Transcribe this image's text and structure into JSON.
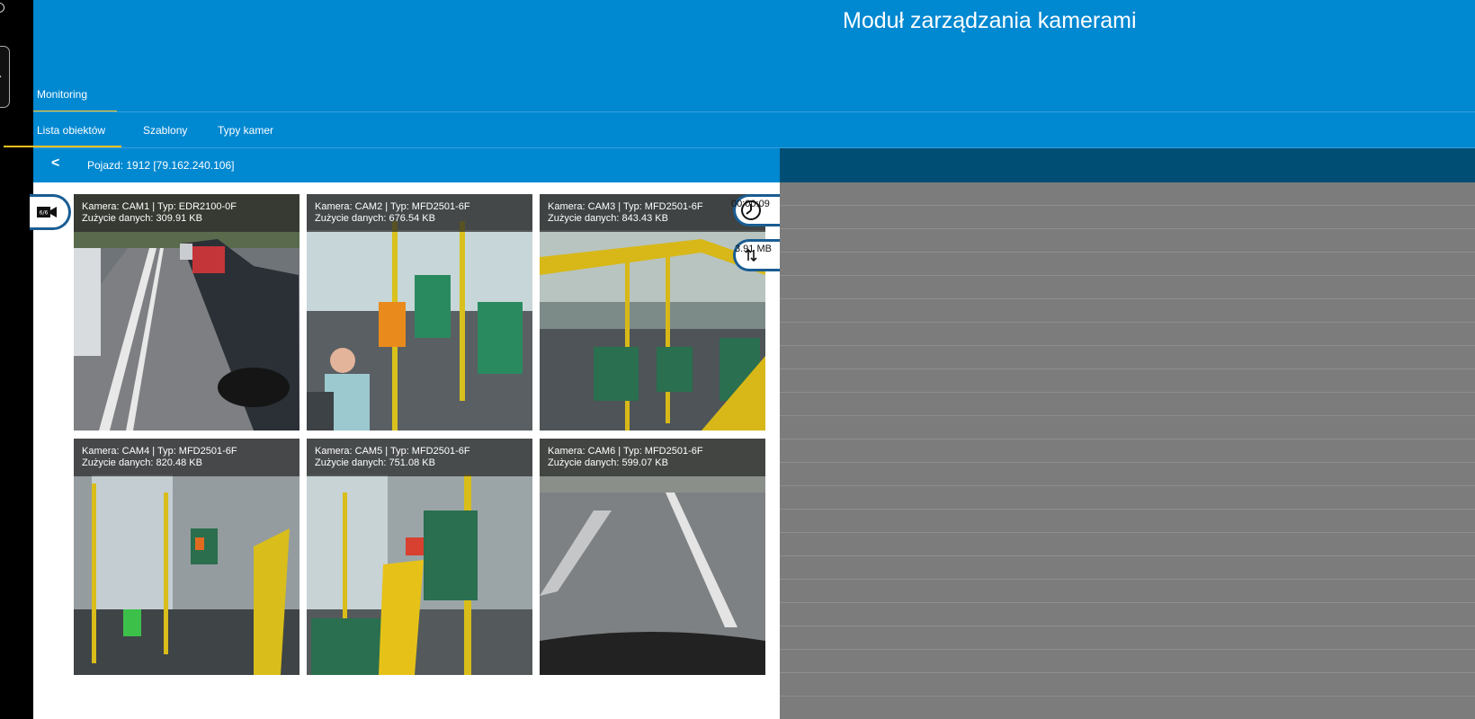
{
  "app": {
    "title": "Moduł zarządzania kamerami"
  },
  "nav": {
    "main_tab": "Monitoring",
    "sub_tabs": [
      "Lista obiektów",
      "Szablony",
      "Typy kamer"
    ]
  },
  "vehicle": {
    "back_icon": "<",
    "label": "Pojazd: 1912 [79.162.240.106]"
  },
  "camera_count_badge": "6/6",
  "stats": {
    "elapsed": "00:00:09",
    "data_total": "3.91 MB"
  },
  "cameras": [
    {
      "title": "Kamera: CAM1 | Typ: EDR2100-0F",
      "usage": "Zużycie danych: 309.91 KB"
    },
    {
      "title": "Kamera: CAM2 | Typ: MFD2501-6F",
      "usage": "Zużycie danych: 676.54 KB"
    },
    {
      "title": "Kamera: CAM3 | Typ: MFD2501-6F",
      "usage": "Zużycie danych: 843.43 KB"
    },
    {
      "title": "Kamera: CAM4 | Typ: MFD2501-6F",
      "usage": "Zużycie danych: 820.48 KB"
    },
    {
      "title": "Kamera: CAM5 | Typ: MFD2501-6F",
      "usage": "Zużycie danych: 751.08 KB"
    },
    {
      "title": "Kamera: CAM6 | Typ: MFD2501-6F",
      "usage": "Zużycie danych: 599.07 KB"
    }
  ],
  "colors": {
    "primary": "#0088d1",
    "dark_header": "#004e73",
    "accent": "#f7c21b",
    "pill_border": "#1a5d93"
  }
}
